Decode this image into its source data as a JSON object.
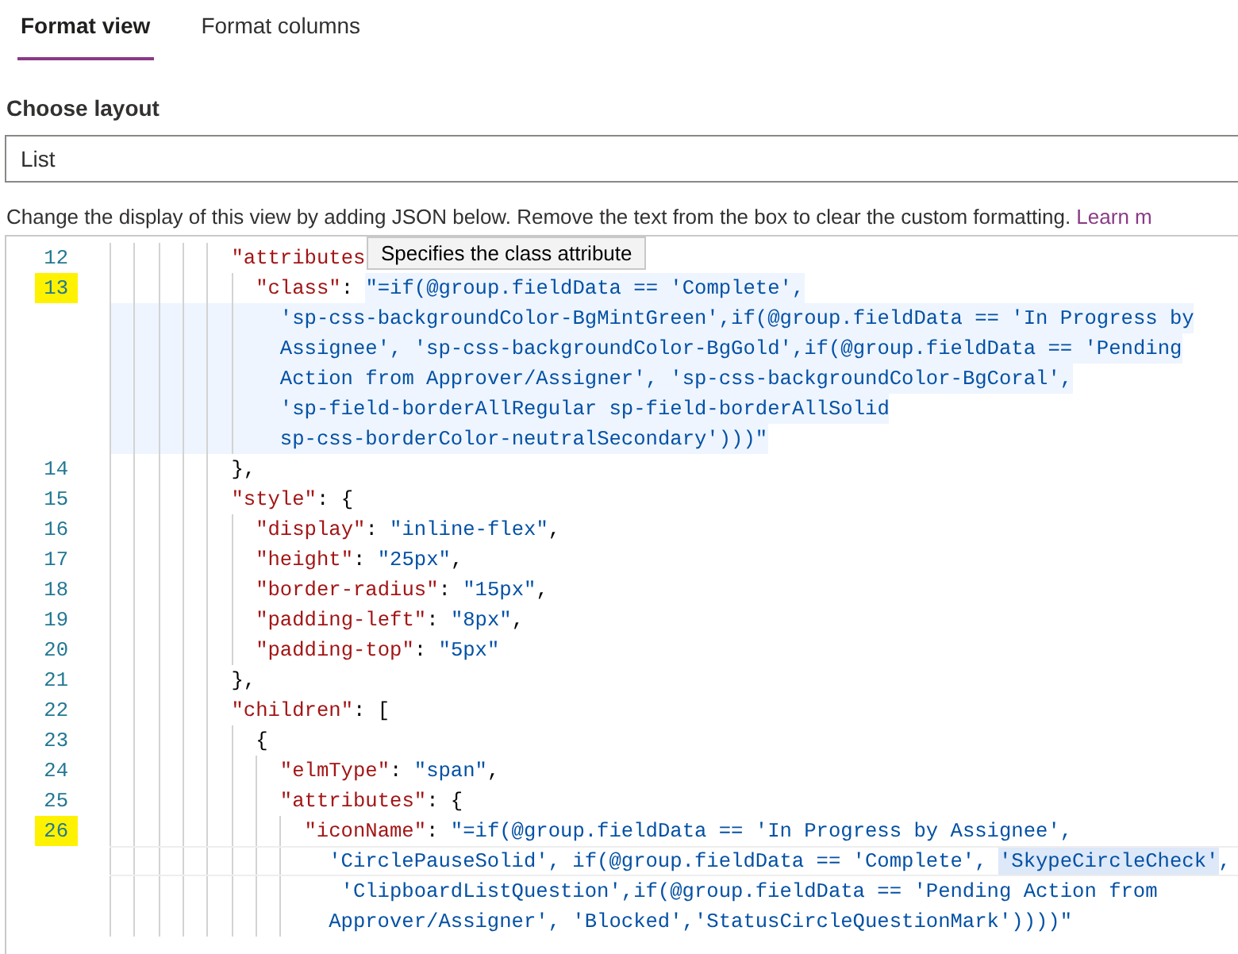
{
  "tabs": [
    {
      "label": "Format view",
      "selected": true
    },
    {
      "label": "Format columns",
      "selected": false
    }
  ],
  "layout": {
    "label": "Choose layout",
    "value": "List"
  },
  "description": {
    "text": "Change the display of this view by adding JSON below. Remove the text from the box to clear the custom formatting.",
    "link": "Learn m"
  },
  "tooltip": "Specifies the class attribute",
  "editor": {
    "lines": [
      {
        "number": "12",
        "marked": false,
        "rows": [
          {
            "tokens": [
              {
                "kind": "key",
                "text": "\"attributes"
              }
            ]
          }
        ],
        "children": [
          {
            "number": "13",
            "marked": true,
            "rows": [
              {
                "tokens": [
                  {
                    "kind": "key",
                    "text": "\"class\""
                  },
                  {
                    "kind": "punct",
                    "text": ": "
                  },
                  {
                    "kind": "string",
                    "text": "\"=if(@group.fieldData == 'Complete',",
                    "selected": true
                  }
                ]
              },
              {
                "tokens": [
                  {
                    "kind": "string",
                    "text": "'sp-css-backgroundColor-BgMintGreen',if(@group.fieldData == 'In Progress by",
                    "selected": true
                  }
                ]
              },
              {
                "tokens": [
                  {
                    "kind": "string",
                    "text": "Assignee', 'sp-css-backgroundColor-BgGold',if(@group.fieldData == 'Pending",
                    "selected": true
                  }
                ]
              },
              {
                "tokens": [
                  {
                    "kind": "string",
                    "text": "Action from Approver/Assigner', 'sp-css-backgroundColor-BgCoral',",
                    "selected": true
                  }
                ]
              },
              {
                "tokens": [
                  {
                    "kind": "string",
                    "text": "'sp-field-borderAllRegular sp-field-borderAllSolid",
                    "selected": true
                  }
                ]
              },
              {
                "tokens": [
                  {
                    "kind": "string",
                    "text": "sp-css-borderColor-neutralSecondary')))\"",
                    "selected": true
                  }
                ]
              }
            ]
          }
        ]
      },
      {
        "number": "14",
        "marked": false,
        "rows": [
          {
            "tokens": [
              {
                "kind": "punct",
                "text": "},"
              }
            ]
          }
        ]
      },
      {
        "number": "15",
        "marked": false,
        "rows": [
          {
            "tokens": [
              {
                "kind": "key",
                "text": "\"style\""
              },
              {
                "kind": "punct",
                "text": ": {"
              }
            ]
          }
        ],
        "children": [
          {
            "number": "16",
            "marked": false,
            "rows": [
              {
                "tokens": [
                  {
                    "kind": "key",
                    "text": "\"display\""
                  },
                  {
                    "kind": "punct",
                    "text": ": "
                  },
                  {
                    "kind": "string",
                    "text": "\"inline-flex\""
                  },
                  {
                    "kind": "punct",
                    "text": ","
                  }
                ]
              }
            ]
          },
          {
            "number": "17",
            "marked": false,
            "rows": [
              {
                "tokens": [
                  {
                    "kind": "key",
                    "text": "\"height\""
                  },
                  {
                    "kind": "punct",
                    "text": ": "
                  },
                  {
                    "kind": "string",
                    "text": "\"25px\""
                  },
                  {
                    "kind": "punct",
                    "text": ","
                  }
                ]
              }
            ]
          },
          {
            "number": "18",
            "marked": false,
            "rows": [
              {
                "tokens": [
                  {
                    "kind": "key",
                    "text": "\"border-radius\""
                  },
                  {
                    "kind": "punct",
                    "text": ": "
                  },
                  {
                    "kind": "string",
                    "text": "\"15px\""
                  },
                  {
                    "kind": "punct",
                    "text": ","
                  }
                ]
              }
            ]
          },
          {
            "number": "19",
            "marked": false,
            "rows": [
              {
                "tokens": [
                  {
                    "kind": "key",
                    "text": "\"padding-left\""
                  },
                  {
                    "kind": "punct",
                    "text": ": "
                  },
                  {
                    "kind": "string",
                    "text": "\"8px\""
                  },
                  {
                    "kind": "punct",
                    "text": ","
                  }
                ]
              }
            ]
          },
          {
            "number": "20",
            "marked": false,
            "rows": [
              {
                "tokens": [
                  {
                    "kind": "key",
                    "text": "\"padding-top\""
                  },
                  {
                    "kind": "punct",
                    "text": ": "
                  },
                  {
                    "kind": "string",
                    "text": "\"5px\""
                  }
                ]
              }
            ]
          }
        ]
      },
      {
        "number": "21",
        "marked": false,
        "rows": [
          {
            "tokens": [
              {
                "kind": "punct",
                "text": "},"
              }
            ]
          }
        ]
      },
      {
        "number": "22",
        "marked": false,
        "rows": [
          {
            "tokens": [
              {
                "kind": "key",
                "text": "\"children\""
              },
              {
                "kind": "punct",
                "text": ": ["
              }
            ]
          }
        ],
        "children": [
          {
            "number": "23",
            "marked": false,
            "rows": [
              {
                "tokens": [
                  {
                    "kind": "punct",
                    "text": "{"
                  }
                ]
              }
            ],
            "children": [
              {
                "number": "24",
                "marked": false,
                "rows": [
                  {
                    "tokens": [
                      {
                        "kind": "key",
                        "text": "\"elmType\""
                      },
                      {
                        "kind": "punct",
                        "text": ": "
                      },
                      {
                        "kind": "string",
                        "text": "\"span\""
                      },
                      {
                        "kind": "punct",
                        "text": ","
                      }
                    ]
                  }
                ]
              },
              {
                "number": "25",
                "marked": false,
                "rows": [
                  {
                    "tokens": [
                      {
                        "kind": "key",
                        "text": "\"attributes\""
                      },
                      {
                        "kind": "punct",
                        "text": ": {"
                      }
                    ]
                  }
                ],
                "children": [
                  {
                    "number": "26",
                    "marked": true,
                    "rows": [
                      {
                        "tokens": [
                          {
                            "kind": "key",
                            "text": "\"iconName\""
                          },
                          {
                            "kind": "punct",
                            "text": ": "
                          },
                          {
                            "kind": "string",
                            "text": "\"=if(@group.fieldData == 'In Progress by Assignee',"
                          }
                        ]
                      },
                      {
                        "current": true,
                        "tokens": [
                          {
                            "kind": "string",
                            "text": "'CirclePauseSolid', if(@group.fieldData == 'Complete', "
                          },
                          {
                            "kind": "string",
                            "text": "'SkypeCircleCheck'",
                            "highlight": true
                          },
                          {
                            "kind": "string",
                            "text": ","
                          }
                        ]
                      },
                      {
                        "tokens": [
                          {
                            "kind": "string",
                            "text": " 'ClipboardListQuestion',if(@group.fieldData == 'Pending Action from"
                          }
                        ]
                      },
                      {
                        "tokens": [
                          {
                            "kind": "string",
                            "text": "Approver/Assigner', 'Blocked','StatusCircleQuestionMark'))))\""
                          }
                        ]
                      }
                    ]
                  }
                ]
              }
            ]
          }
        ]
      }
    ]
  }
}
